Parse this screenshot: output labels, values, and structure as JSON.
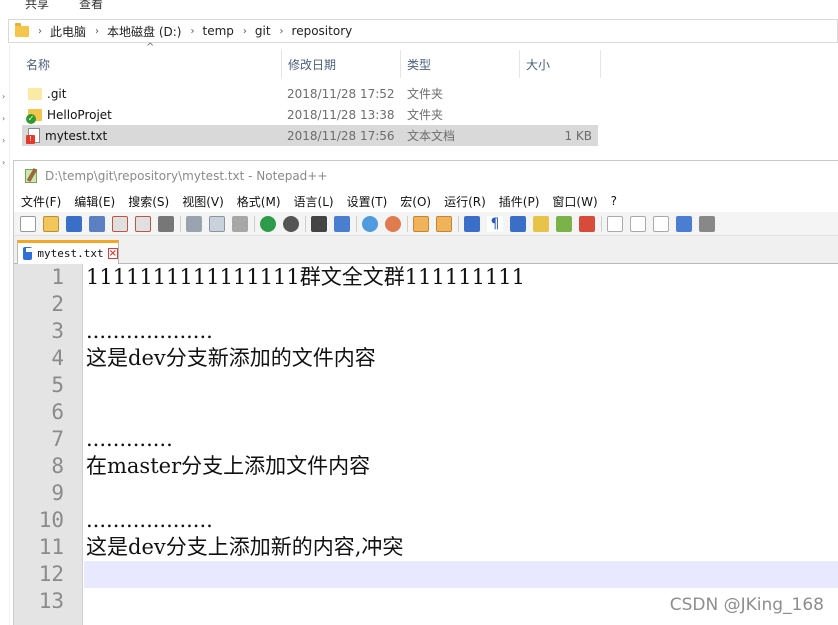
{
  "ribbon": {
    "tab_share": "共享",
    "tab_view": "查看"
  },
  "address": {
    "crumbs": [
      "此电脑",
      "本地磁盘 (D:)",
      "temp",
      "git",
      "repository"
    ]
  },
  "columns": {
    "name": "名称",
    "date": "修改日期",
    "type": "类型",
    "size": "大小"
  },
  "files": [
    {
      "name": ".git",
      "date": "2018/11/28 17:52",
      "type": "文件夹",
      "size": "",
      "icon": "folder-icon"
    },
    {
      "name": "HelloProjet",
      "date": "2018/11/28 13:38",
      "type": "文件夹",
      "size": "",
      "icon": "folder-synced-icon"
    },
    {
      "name": "mytest.txt",
      "date": "2018/11/28 17:56",
      "type": "文本文档",
      "size": "1 KB",
      "icon": "text-file-conflict-icon"
    }
  ],
  "notepad": {
    "title": "D:\\temp\\git\\repository\\mytest.txt - Notepad++",
    "menu": [
      "文件(F)",
      "编辑(E)",
      "搜索(S)",
      "视图(V)",
      "格式(M)",
      "语言(L)",
      "设置(T)",
      "宏(O)",
      "运行(R)",
      "插件(P)",
      "窗口(W)",
      "?"
    ],
    "tab": {
      "name": "mytest.txt"
    },
    "lines": [
      {
        "n": "1",
        "text": "1111111111111111群文全文群111111111"
      },
      {
        "n": "2",
        "text": ""
      },
      {
        "n": "3",
        "text": "..................."
      },
      {
        "n": "4",
        "text": "这是dev分支新添加的文件内容"
      },
      {
        "n": "5",
        "text": ""
      },
      {
        "n": "6",
        "text": ""
      },
      {
        "n": "7",
        "text": "............."
      },
      {
        "n": "8",
        "text": "在master分支上添加文件内容"
      },
      {
        "n": "9",
        "text": ""
      },
      {
        "n": "10",
        "text": "..................."
      },
      {
        "n": "11",
        "text": "这是dev分支上添加新的内容,冲突"
      },
      {
        "n": "12",
        "text": ""
      },
      {
        "n": "13",
        "text": ""
      }
    ],
    "current_line": "12"
  },
  "watermark": "CSDN @JKing_168",
  "colors": {
    "current_line_bg": "#e8e8ff",
    "tab_accent": "#f5a623",
    "selected_row": "#d9d9d9"
  }
}
